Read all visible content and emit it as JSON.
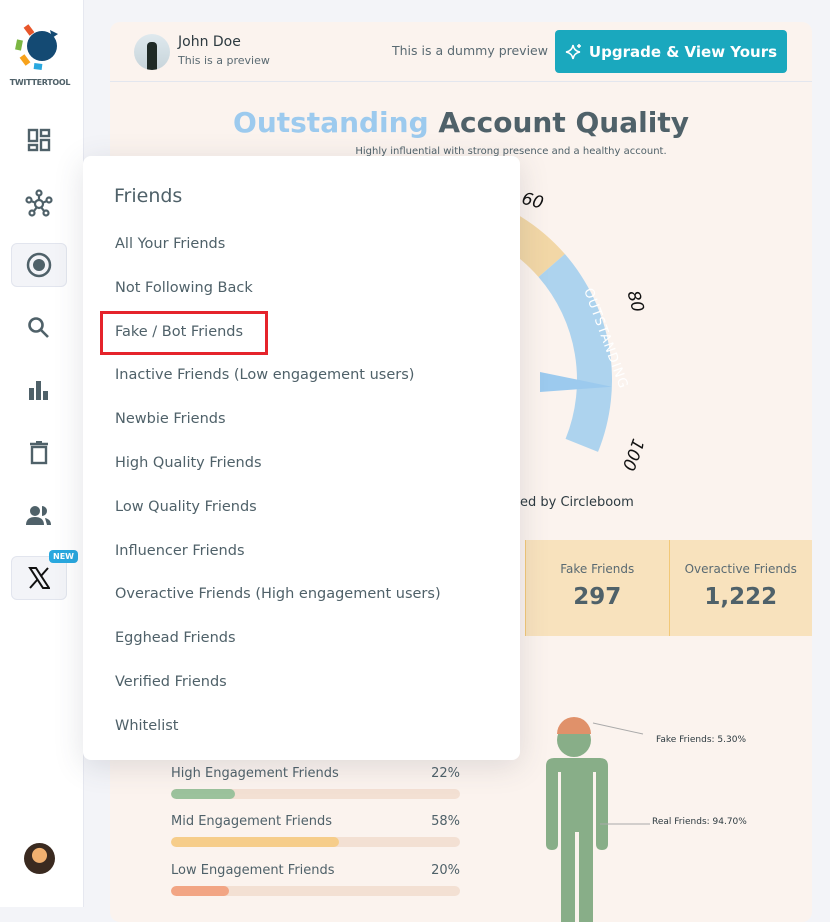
{
  "sidebar": {
    "brand": "TWITTERTOOL",
    "items": [
      {
        "name": "dashboard",
        "icon": "dashboard-icon"
      },
      {
        "name": "network",
        "icon": "network-icon"
      },
      {
        "name": "circle",
        "icon": "target-icon",
        "active": true
      },
      {
        "name": "search",
        "icon": "search-icon"
      },
      {
        "name": "analytics",
        "icon": "bar-chart-icon"
      },
      {
        "name": "delete",
        "icon": "trash-icon"
      },
      {
        "name": "users",
        "icon": "users-icon"
      },
      {
        "name": "x",
        "icon": "x-logo-icon",
        "badge": "NEW"
      }
    ]
  },
  "header": {
    "name": "John Doe",
    "subtitle": "This is a preview",
    "dummy_note": "This is a dummy preview",
    "upgrade_label": "Upgrade & View Yours"
  },
  "quality": {
    "highlight": "Outstanding",
    "title_rest": "Account Quality",
    "subtitle": "Highly influential with strong presence and a healthy account.",
    "gauge": {
      "labels": [
        "60",
        "80",
        "100"
      ],
      "segment_label": "OUTSTANDING",
      "colors": {
        "good": "#f2d7a6",
        "outstanding": "#add3ee",
        "needle": "#9ccaee"
      }
    },
    "powered": "ed by Circleboom"
  },
  "stats": [
    {
      "label": "Fake Friends",
      "value": "297"
    },
    {
      "label": "Overactive Friends",
      "value": "1,222"
    }
  ],
  "engagement": [
    {
      "label": "High Engagement Friends",
      "pct": "22%",
      "value": 22,
      "color": "#9bc29c"
    },
    {
      "label": "Mid Engagement Friends",
      "pct": "58%",
      "value": 58,
      "color": "#f6cd8a"
    },
    {
      "label": "Low Engagement Friends",
      "pct": "20%",
      "value": 20,
      "color": "#f2a584"
    }
  ],
  "figure": {
    "fake": "Fake Friends: 5.30%",
    "real": "Real Friends: 94.70%"
  },
  "dropdown": {
    "title": "Friends",
    "items": [
      "All Your Friends",
      "Not Following Back",
      "Fake / Bot Friends",
      "Inactive Friends (Low engagement users)",
      "Newbie Friends",
      "High Quality Friends",
      "Low Quality Friends",
      "Influencer Friends",
      "Overactive Friends (High engagement users)",
      "Egghead Friends",
      "Verified Friends",
      "Whitelist"
    ],
    "highlighted": "Fake / Bot Friends"
  }
}
